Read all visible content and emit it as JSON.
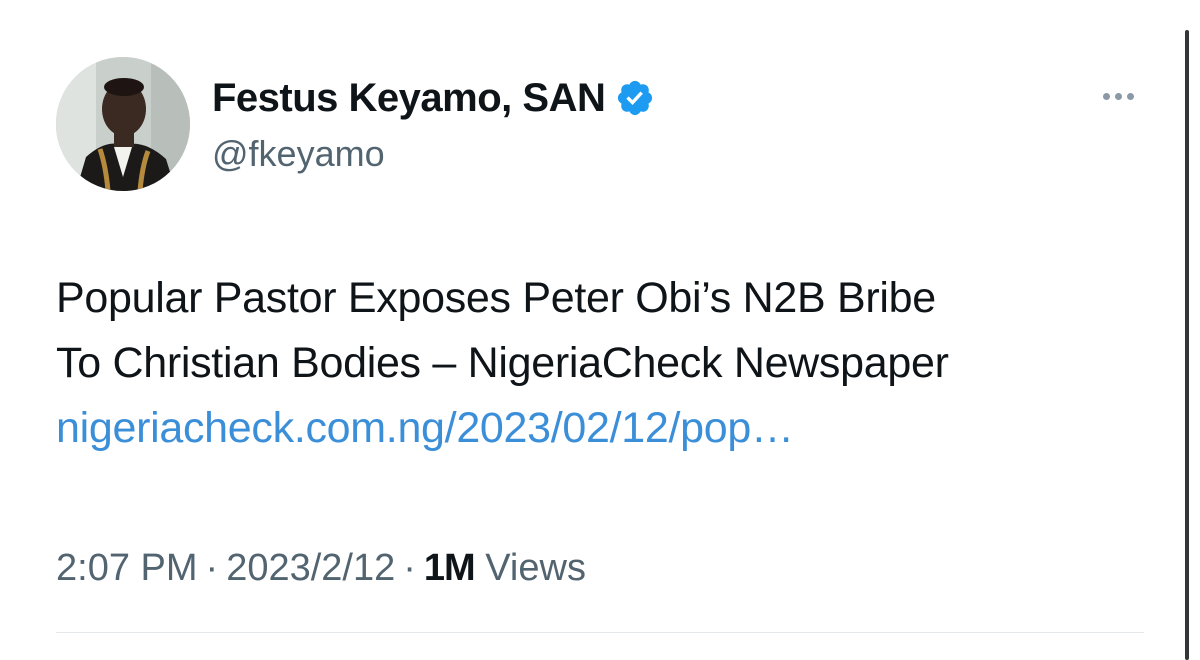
{
  "author": {
    "display_name": "Festus Keyamo, SAN",
    "handle": "@fkeyamo",
    "verified": true,
    "avatar_icon": "profile-photo"
  },
  "tweet": {
    "text_line_1": "Popular Pastor Exposes Peter Obi’s N2B Bribe",
    "text_line_2": "To Christian Bodies – NigeriaCheck Newspaper",
    "link_text": "nigeriacheck.com.ng/2023/02/12/pop…"
  },
  "meta": {
    "time": "2:07 PM",
    "separator": "·",
    "date": "2023/2/12",
    "views_count": "1M",
    "views_label": "Views"
  },
  "colors": {
    "link": "#3b8fd9",
    "verified_badge": "#1d9bf0",
    "secondary_text": "#536471"
  },
  "icons": {
    "more": "more-horizontal-icon",
    "verified": "verified-badge-icon"
  }
}
